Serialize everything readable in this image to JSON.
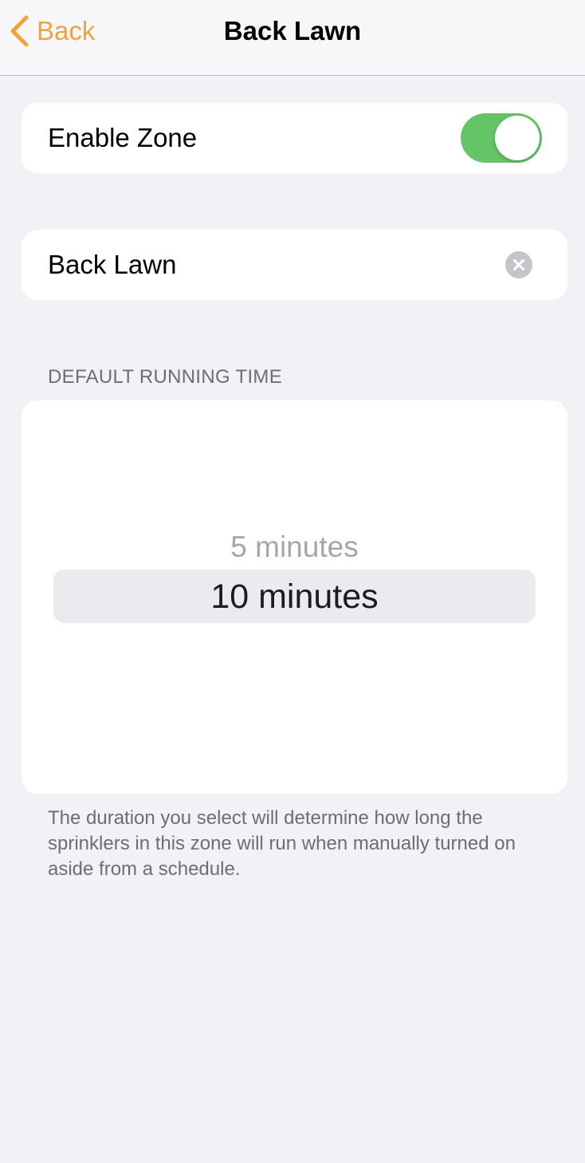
{
  "colors": {
    "accent": "#f0a33a",
    "toggle_on": "#65c466",
    "background": "#f1f1f6"
  },
  "nav": {
    "back_label": "Back",
    "back_icon": "chevron-left-icon",
    "title": "Back Lawn"
  },
  "enable_zone": {
    "label": "Enable Zone",
    "enabled": true
  },
  "zone_name": {
    "value": "Back Lawn",
    "clear_icon": "clear-circle-icon"
  },
  "running_time": {
    "header": "DEFAULT RUNNING TIME",
    "options": [
      "5 minutes",
      "10 minutes"
    ],
    "selected": "10 minutes",
    "footer": "The duration you select will determine how long the sprinklers in this zone will run when manually turned on aside from a schedule."
  }
}
